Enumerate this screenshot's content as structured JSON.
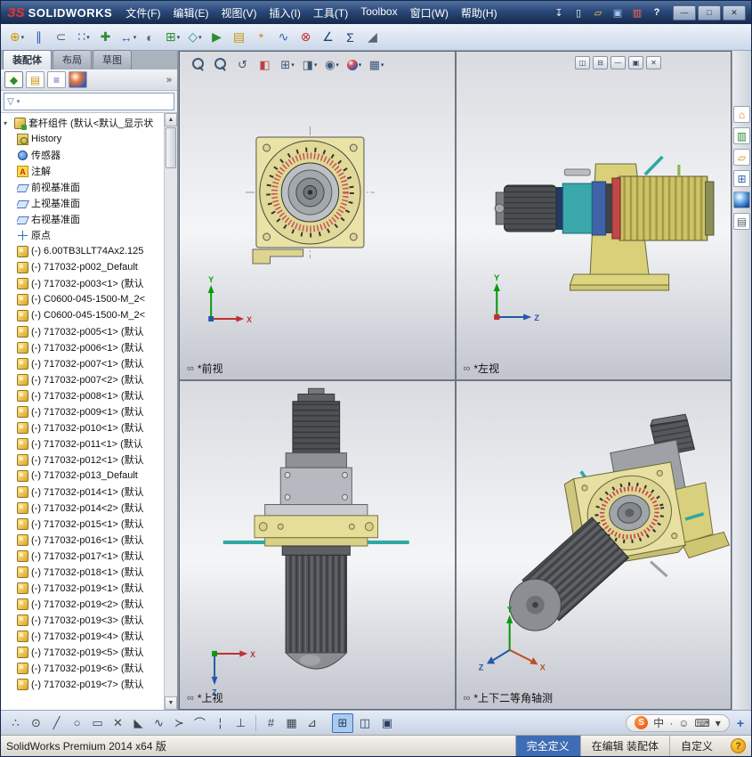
{
  "colors": {
    "titlebar": "#16294b",
    "accent_blue": "#3f6db5",
    "solidworks_red": "#e8332a",
    "part_yellow": "#e6dfa0",
    "teal_pin": "#2fa8a0"
  },
  "window": {
    "logo_mark": "ЗS",
    "logo_text": "SOLIDWORKS",
    "menus": [
      "文件(F)",
      "编辑(E)",
      "视图(V)",
      "插入(I)",
      "工具(T)",
      "Toolbox",
      "窗口(W)",
      "帮助(H)"
    ],
    "quick_icons": [
      {
        "name": "menu-pin-icon",
        "glyph": "↧"
      },
      {
        "name": "new-document-icon",
        "glyph": "▯",
        "cls": "q-new"
      },
      {
        "name": "open-document-icon",
        "glyph": "▱",
        "cls": "q-open"
      },
      {
        "name": "save-icon",
        "glyph": "▣",
        "cls": "q-save"
      },
      {
        "name": "options-icon",
        "glyph": "▥",
        "cls": "q-opt"
      },
      {
        "name": "help-icon",
        "glyph": "?",
        "cls": "q-help"
      }
    ],
    "window_buttons": [
      {
        "name": "minimize-button",
        "glyph": "—"
      },
      {
        "name": "maximize-button",
        "glyph": "□"
      },
      {
        "name": "close-button",
        "glyph": "✕"
      }
    ]
  },
  "main_toolbar": {
    "icons": [
      {
        "name": "insert-components-icon",
        "glyph": "⊕",
        "cls": "c-gold",
        "dd": "▾"
      },
      {
        "name": "mate-icon",
        "glyph": "∥",
        "cls": "c-blue",
        "dd": ""
      },
      {
        "name": "attachment-icon",
        "glyph": "⊂",
        "cls": "c-gray",
        "dd": ""
      },
      {
        "name": "linear-component-pattern-icon",
        "glyph": "∷",
        "cls": "c-blue",
        "dd": "▾"
      },
      {
        "name": "smart-fasteners-icon",
        "glyph": "✚",
        "cls": "c-green",
        "dd": ""
      },
      {
        "name": "move-component-icon",
        "glyph": "↔",
        "cls": "c-blue",
        "dd": "▾"
      },
      {
        "name": "show-hidden-components-icon",
        "glyph": "◐",
        "cls": "c-gray",
        "dd": ""
      },
      {
        "name": "assembly-features-icon",
        "glyph": "⊞",
        "cls": "c-green",
        "dd": "▾"
      },
      {
        "name": "reference-geometry-icon",
        "glyph": "◇",
        "cls": "c-teal",
        "dd": "▾"
      },
      {
        "name": "new-motion-study-icon",
        "glyph": "▶",
        "cls": "c-green",
        "dd": ""
      },
      {
        "name": "bill-of-materials-icon",
        "glyph": "▤",
        "cls": "c-gold",
        "dd": ""
      },
      {
        "name": "exploded-view-icon",
        "glyph": "*",
        "cls": "c-orange",
        "dd": ""
      },
      {
        "name": "explode-line-sketch-icon",
        "glyph": "∿",
        "cls": "c-blue",
        "dd": ""
      },
      {
        "name": "interference-detection-icon",
        "glyph": "⊗",
        "cls": "c-red",
        "dd": ""
      },
      {
        "name": "measure-icon",
        "glyph": "∠",
        "cls": "c-navy",
        "dd": ""
      },
      {
        "name": "mass-properties-icon",
        "glyph": "Σ",
        "cls": "c-navy",
        "dd": ""
      },
      {
        "name": "section-properties-icon",
        "glyph": "◢",
        "cls": "c-gray",
        "dd": ""
      }
    ]
  },
  "command_tabs": [
    {
      "name": "tab-assembly",
      "label": "装配体",
      "active": true
    },
    {
      "name": "tab-layout",
      "label": "布局"
    },
    {
      "name": "tab-sketch",
      "label": "草图"
    }
  ],
  "left_panel": {
    "pane_tabs": [
      {
        "name": "featuremanager-tab-icon",
        "glyph": "◆",
        "cls": "pt-green",
        "active": true
      },
      {
        "name": "propertymanager-tab-icon",
        "glyph": "▤",
        "cls": "pt-gold"
      },
      {
        "name": "configurationmanager-tab-icon",
        "glyph": "≡",
        "cls": "pt-purple"
      },
      {
        "name": "displaymanager-tab-icon",
        "glyph": "",
        "cls": "pt-ball"
      }
    ],
    "overflow_chevron": "»",
    "filter_placeholder": ""
  },
  "tree": {
    "root_expander": "▾",
    "root": "套杆组件 (默认<默认_显示状",
    "items": [
      {
        "cls": "ti-history",
        "label": "History"
      },
      {
        "cls": "ti-sensor",
        "label": "传感器"
      },
      {
        "cls": "ti-annot",
        "label": "注解"
      },
      {
        "cls": "ti-plane",
        "label": "前视基准面"
      },
      {
        "cls": "ti-plane",
        "label": "上视基准面"
      },
      {
        "cls": "ti-plane",
        "label": "右视基准面"
      },
      {
        "cls": "ti-origin",
        "label": "原点"
      },
      {
        "cls": "ti-part",
        "label": "(-) 6.00TB3LLT74Ax2.125"
      },
      {
        "cls": "ti-part",
        "label": "(-) 717032-p002_Default"
      },
      {
        "cls": "ti-part",
        "label": "(-) 717032-p003<1> (默认"
      },
      {
        "cls": "ti-part",
        "label": "(-) C0600-045-1500-M_2<"
      },
      {
        "cls": "ti-part",
        "label": "(-) C0600-045-1500-M_2<"
      },
      {
        "cls": "ti-part",
        "label": "(-) 717032-p005<1> (默认"
      },
      {
        "cls": "ti-part",
        "label": "(-) 717032-p006<1> (默认"
      },
      {
        "cls": "ti-part",
        "label": "(-) 717032-p007<1> (默认"
      },
      {
        "cls": "ti-part",
        "label": "(-) 717032-p007<2> (默认"
      },
      {
        "cls": "ti-part",
        "label": "(-) 717032-p008<1> (默认"
      },
      {
        "cls": "ti-part",
        "label": "(-) 717032-p009<1> (默认"
      },
      {
        "cls": "ti-part",
        "label": "(-) 717032-p010<1> (默认"
      },
      {
        "cls": "ti-part",
        "label": "(-) 717032-p011<1> (默认"
      },
      {
        "cls": "ti-part",
        "label": "(-) 717032-p012<1> (默认"
      },
      {
        "cls": "ti-part",
        "label": "(-) 717032-p013_Default"
      },
      {
        "cls": "ti-part",
        "label": "(-) 717032-p014<1> (默认"
      },
      {
        "cls": "ti-part",
        "label": "(-) 717032-p014<2> (默认"
      },
      {
        "cls": "ti-part",
        "label": "(-) 717032-p015<1> (默认"
      },
      {
        "cls": "ti-part",
        "label": "(-) 717032-p016<1> (默认"
      },
      {
        "cls": "ti-part",
        "label": "(-) 717032-p017<1> (默认"
      },
      {
        "cls": "ti-part",
        "label": "(-) 717032-p018<1> (默认"
      },
      {
        "cls": "ti-part",
        "label": "(-) 717032-p019<1> (默认"
      },
      {
        "cls": "ti-part",
        "label": "(-) 717032-p019<2> (默认"
      },
      {
        "cls": "ti-part",
        "label": "(-) 717032-p019<3> (默认"
      },
      {
        "cls": "ti-part",
        "label": "(-) 717032-p019<4> (默认"
      },
      {
        "cls": "ti-part",
        "label": "(-) 717032-p019<5> (默认"
      },
      {
        "cls": "ti-part",
        "label": "(-) 717032-p019<6> (默认"
      },
      {
        "cls": "ti-part",
        "label": "(-) 717032-p019<7> (默认"
      }
    ]
  },
  "viewport_label_icon": "∞",
  "axis_labels": {
    "x": "X",
    "y": "Y",
    "z": "Z"
  },
  "viewports": [
    {
      "label": "*前视"
    },
    {
      "label": "*左视"
    },
    {
      "label": "*上视"
    },
    {
      "label": "*上下二等角轴测"
    }
  ],
  "headsup": {
    "icons": [
      {
        "name": "zoom-fit-icon",
        "glyph": "",
        "cls": "i-mag",
        "dd": ""
      },
      {
        "name": "zoom-area-icon",
        "glyph": "",
        "cls": "i-mag",
        "dd": ""
      },
      {
        "name": "previous-view-icon",
        "glyph": "↺",
        "dd": ""
      },
      {
        "name": "section-view-icon",
        "glyph": "◧",
        "cls": "hu-sec",
        "dd": ""
      },
      {
        "name": "view-orientation-icon",
        "glyph": "⊞",
        "dd": "▾"
      },
      {
        "name": "display-style-icon",
        "glyph": "◨",
        "dd": "▾"
      },
      {
        "name": "hide-show-items-icon",
        "glyph": "◉",
        "dd": "▾"
      },
      {
        "name": "edit-appearance-icon",
        "glyph": "",
        "cls": "c-ball",
        "dd": "▾"
      },
      {
        "name": "apply-scene-icon",
        "glyph": "▦",
        "dd": "▾"
      }
    ]
  },
  "doc_controls": [
    {
      "name": "doc-new-window-icon",
      "glyph": "◫"
    },
    {
      "name": "doc-split-icon",
      "glyph": "⊟"
    },
    {
      "name": "doc-minimize-icon",
      "glyph": "—"
    },
    {
      "name": "doc-restore-icon",
      "glyph": "▣"
    },
    {
      "name": "doc-close-icon",
      "glyph": "✕"
    }
  ],
  "task_pane": {
    "icons": [
      {
        "name": "solidworks-resources-icon",
        "glyph": "⌂",
        "cls": "tp-home"
      },
      {
        "name": "design-library-icon",
        "glyph": "▥",
        "cls": "tp-lib"
      },
      {
        "name": "file-explorer-icon",
        "glyph": "▱",
        "cls": "tp-folder"
      },
      {
        "name": "view-palette-icon",
        "glyph": "⊞",
        "cls": "tp-pal"
      },
      {
        "name": "appearances-icon",
        "glyph": "",
        "cls": "tp-ball"
      },
      {
        "name": "custom-properties-icon",
        "glyph": "▤",
        "cls": "tp-props"
      }
    ]
  },
  "sketch_toolbar": {
    "tools": [
      {
        "name": "sketch-point-icon",
        "glyph": "∴"
      },
      {
        "name": "circle-tool-icon",
        "glyph": "⊙"
      },
      {
        "name": "line-tool-icon",
        "glyph": "╱"
      },
      {
        "name": "ellipse-tool-icon",
        "glyph": "○"
      },
      {
        "name": "rectangle-tool-icon",
        "glyph": "▭"
      },
      {
        "name": "trim-entities-icon",
        "glyph": "✕"
      },
      {
        "name": "chamfer-tool-icon",
        "glyph": "◣"
      },
      {
        "name": "spline-tool-icon",
        "glyph": "∿"
      },
      {
        "name": "convert-entities-icon",
        "glyph": "≻"
      },
      {
        "name": "arc-tool-icon",
        "glyph": "⌒"
      },
      {
        "name": "centerline-tool-icon",
        "glyph": "¦"
      },
      {
        "name": "perpendicular-tool-icon",
        "glyph": "⊥"
      }
    ],
    "mid_icons": [
      {
        "name": "sketch-settings-icon",
        "glyph": "#"
      },
      {
        "name": "grid-snap-icon",
        "glyph": "▦"
      },
      {
        "name": "section-tool-icon",
        "glyph": "⊿"
      }
    ],
    "view_buttons": [
      {
        "name": "four-view-button",
        "glyph": "⊞",
        "active": true
      },
      {
        "name": "two-view-button",
        "glyph": "◫"
      },
      {
        "name": "single-view-button",
        "glyph": "▣"
      }
    ],
    "ime_icons": [
      {
        "name": "sogou-logo-icon",
        "glyph": "S",
        "cls": "ime-s"
      },
      {
        "name": "input-mode-icon",
        "glyph": "中"
      },
      {
        "name": "punctuation-icon",
        "glyph": "·"
      },
      {
        "name": "emoticon-icon",
        "glyph": "☺"
      },
      {
        "name": "virtual-keyboard-icon",
        "glyph": "⌨"
      },
      {
        "name": "ime-menu-icon",
        "glyph": "▾"
      }
    ],
    "pin_glyph": "+"
  },
  "status_bar": {
    "left": "SolidWorks Premium 2014 x64 版",
    "segments": [
      {
        "name": "definition-status",
        "label": "完全定义",
        "cls": "seg-blue"
      },
      {
        "name": "edit-status",
        "label": "在编辑 装配体"
      },
      {
        "name": "custom-status",
        "label": "自定义"
      }
    ],
    "help": "?"
  }
}
